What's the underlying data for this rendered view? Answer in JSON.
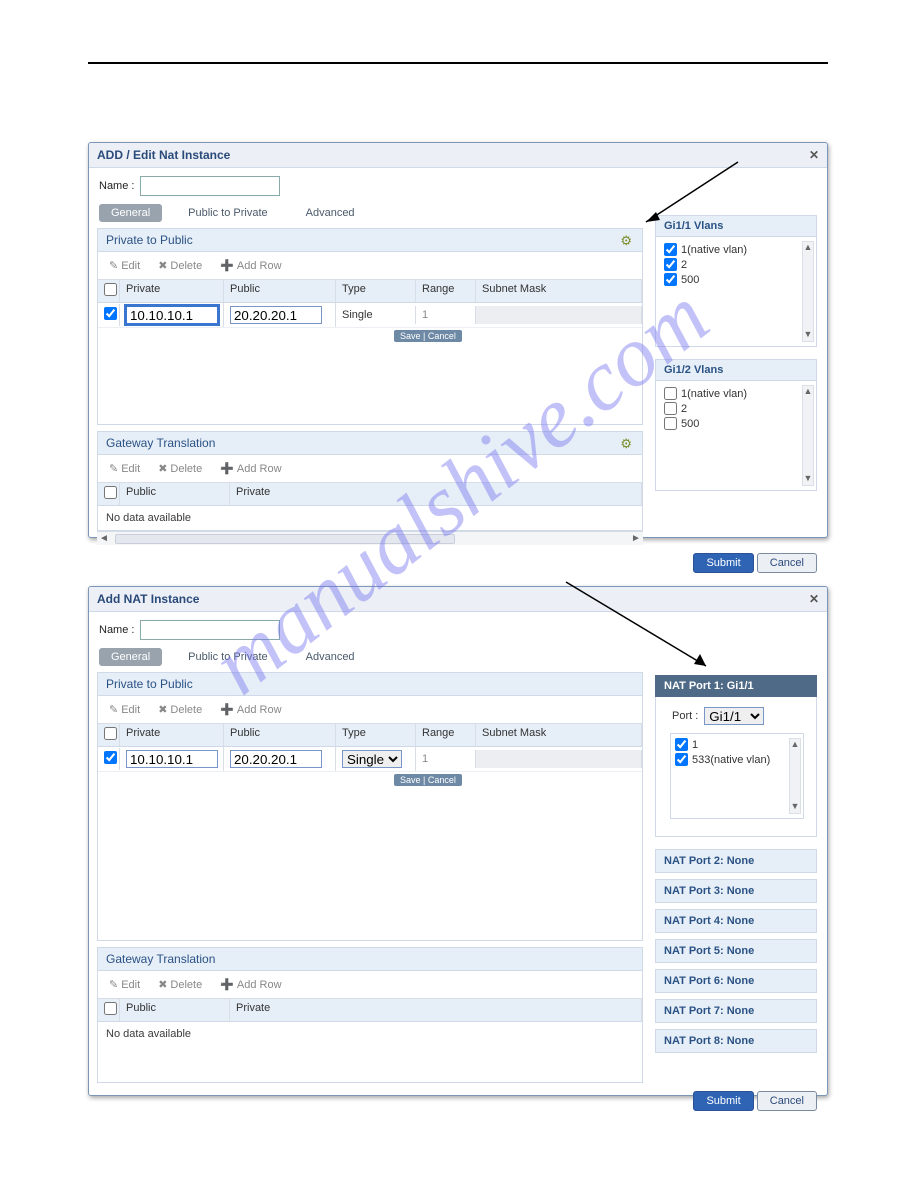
{
  "dialog1": {
    "title": "ADD / Edit Nat Instance",
    "name_label": "Name :",
    "name_value": "",
    "tabs": {
      "general": "General",
      "p2p": "Public to Private",
      "adv": "Advanced"
    },
    "priv2pub": {
      "header": "Private to Public",
      "edit": "Edit",
      "delete": "Delete",
      "addrow": "Add Row",
      "cols": {
        "private": "Private",
        "public": "Public",
        "type": "Type",
        "range": "Range",
        "mask": "Subnet Mask"
      },
      "row": {
        "private": "10.10.10.1",
        "public": "20.20.20.1",
        "type": "Single",
        "range": "1",
        "mask": ""
      },
      "savecancel": "Save | Cancel"
    },
    "gateway": {
      "header": "Gateway Translation",
      "edit": "Edit",
      "delete": "Delete",
      "addrow": "Add Row",
      "cols": {
        "public": "Public",
        "private": "Private"
      },
      "nodata": "No data available"
    },
    "side1": {
      "header": "Gi1/1 Vlans",
      "v1": "1(native vlan)",
      "v2": "2",
      "v3": "500"
    },
    "side2": {
      "header": "Gi1/2 Vlans",
      "v1": "1(native vlan)",
      "v2": "2",
      "v3": "500"
    },
    "submit": "Submit",
    "cancel": "Cancel"
  },
  "dialog2": {
    "title": "Add NAT Instance",
    "name_label": "Name :",
    "name_value": "",
    "tabs": {
      "general": "General",
      "p2p": "Public to Private",
      "adv": "Advanced"
    },
    "priv2pub": {
      "header": "Private to Public",
      "edit": "Edit",
      "delete": "Delete",
      "addrow": "Add Row",
      "cols": {
        "private": "Private",
        "public": "Public",
        "type": "Type",
        "range": "Range",
        "mask": "Subnet Mask"
      },
      "row": {
        "private": "10.10.10.1",
        "public": "20.20.20.1",
        "type": "Single",
        "range": "1",
        "mask": ""
      },
      "savecancel": "Save | Cancel"
    },
    "gateway": {
      "header": "Gateway Translation",
      "edit": "Edit",
      "delete": "Delete",
      "addrow": "Add Row",
      "cols": {
        "public": "Public",
        "private": "Private"
      },
      "nodata": "No data available"
    },
    "natport": {
      "header": "NAT Port 1: Gi1/1",
      "port_label": "Port :",
      "port_value": "Gi1/1",
      "v1": "1",
      "v2": "533(native vlan)",
      "rows": [
        "NAT Port 2: None",
        "NAT Port 3: None",
        "NAT Port 4: None",
        "NAT Port 5: None",
        "NAT Port 6: None",
        "NAT Port 7: None",
        "NAT Port 8: None"
      ]
    },
    "submit": "Submit",
    "cancel": "Cancel"
  }
}
